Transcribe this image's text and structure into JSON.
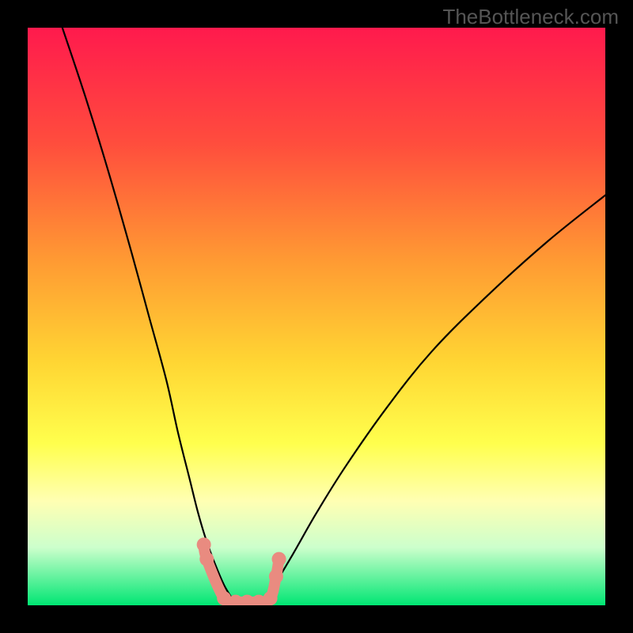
{
  "watermark": "TheBottleneck.com",
  "chart_data": {
    "type": "line",
    "title": "",
    "xlabel": "",
    "ylabel": "",
    "xlim": [
      0,
      100
    ],
    "ylim": [
      0,
      100
    ],
    "grid": false,
    "legend": false,
    "background_gradient": [
      {
        "pos": 0.0,
        "color": "#ff1a4d"
      },
      {
        "pos": 0.2,
        "color": "#ff4d3d"
      },
      {
        "pos": 0.4,
        "color": "#ff9933"
      },
      {
        "pos": 0.58,
        "color": "#ffd633"
      },
      {
        "pos": 0.72,
        "color": "#ffff4d"
      },
      {
        "pos": 0.82,
        "color": "#ffffb3"
      },
      {
        "pos": 0.9,
        "color": "#ccffcc"
      },
      {
        "pos": 1.0,
        "color": "#00e673"
      }
    ],
    "series": [
      {
        "name": "left-curve",
        "x": [
          6,
          10,
          14,
          18,
          21,
          24,
          26,
          28,
          29.5,
          31,
          32.5,
          34,
          35.5
        ],
        "y": [
          100,
          88,
          75,
          61,
          50,
          39,
          30,
          22,
          16,
          11,
          7,
          3.5,
          1
        ]
      },
      {
        "name": "right-curve",
        "x": [
          41,
          43,
          46,
          50,
          55,
          62,
          70,
          80,
          90,
          100
        ],
        "y": [
          1,
          4,
          9,
          16,
          24,
          34,
          44,
          54,
          63,
          71
        ]
      }
    ],
    "markers": {
      "name": "salmon-beads",
      "x": [
        30.5,
        31,
        34,
        36,
        38,
        40,
        42,
        43,
        43.5
      ],
      "y": [
        10.5,
        8,
        1.2,
        0.6,
        0.6,
        0.6,
        1.2,
        5,
        8
      ],
      "color": "#e98b80",
      "size": 9
    }
  }
}
